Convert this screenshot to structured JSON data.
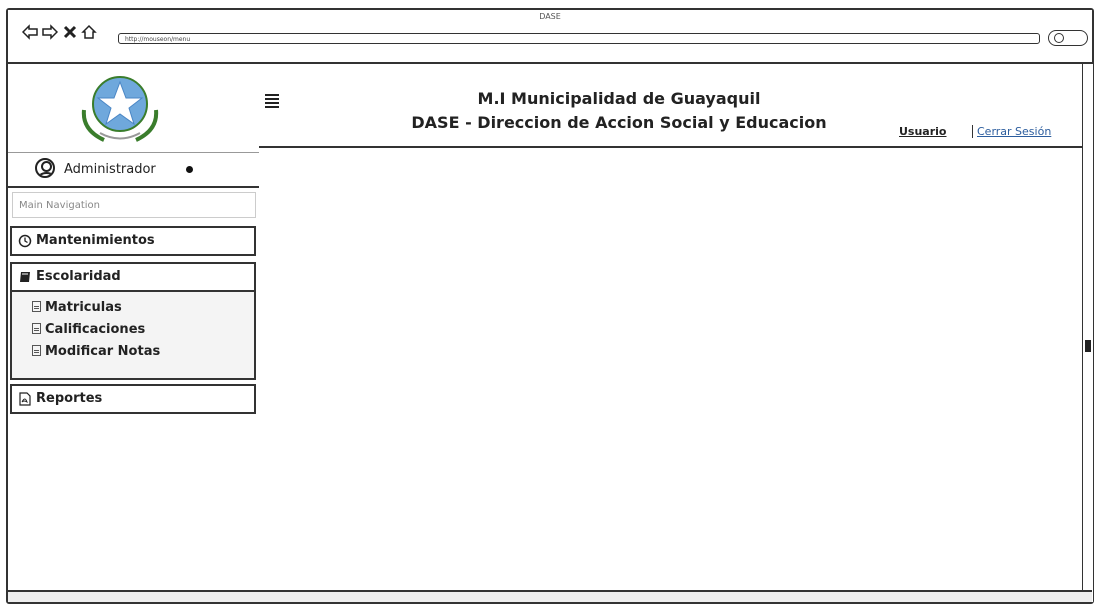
{
  "window": {
    "title": "DASE",
    "url": "http://mouseon/menu"
  },
  "sidebar": {
    "user_name": "Administrador",
    "nav_header": "Main Navigation",
    "menu": {
      "mantenimientos": "Mantenimientos",
      "escolaridad": "Escolaridad",
      "reportes": "Reportes"
    },
    "submenu": [
      "Matriculas",
      "Calificaciones",
      "Modificar Notas"
    ]
  },
  "header": {
    "title_line1": "M.I Municipalidad de Guayaquil",
    "title_line2": "DASE - Direccion de Accion Social y Educacion",
    "user_link": "Usuario",
    "logout_link": "Cerrar Sesión"
  },
  "icons": {
    "logo": "municipal-seal-icon",
    "mantenimientos": "clock-icon",
    "escolaridad": "book-icon",
    "submenu_item": "document-icon",
    "reportes": "pdf-icon"
  },
  "colors": {
    "link": "#2c5d9e",
    "seal": "#6fa8dc"
  }
}
